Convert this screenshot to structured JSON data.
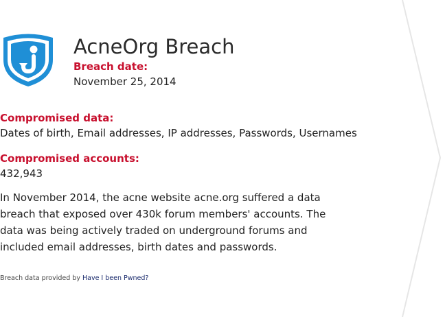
{
  "breach": {
    "title": "AcneOrg Breach",
    "date_label": "Breach date:",
    "date": "November 25, 2014",
    "compromised_data_label": "Compromised data:",
    "compromised_data": "Dates of birth, Email addresses, IP addresses, Passwords, Usernames",
    "accounts_label": "Compromised accounts:",
    "accounts": "432,943",
    "description": "In November 2014, the acne website acne.org suffered a data breach that exposed over 430k forum members' accounts. The data was being actively traded on underground forums and included email addresses, birth dates and passwords."
  },
  "footer": {
    "prefix": "Breach data provided by",
    "link": "Have I been Pwned?"
  },
  "colors": {
    "accent": "#c8102e",
    "shield": "#1f8fd6"
  },
  "icons": {
    "logo": "shield-info-icon"
  }
}
